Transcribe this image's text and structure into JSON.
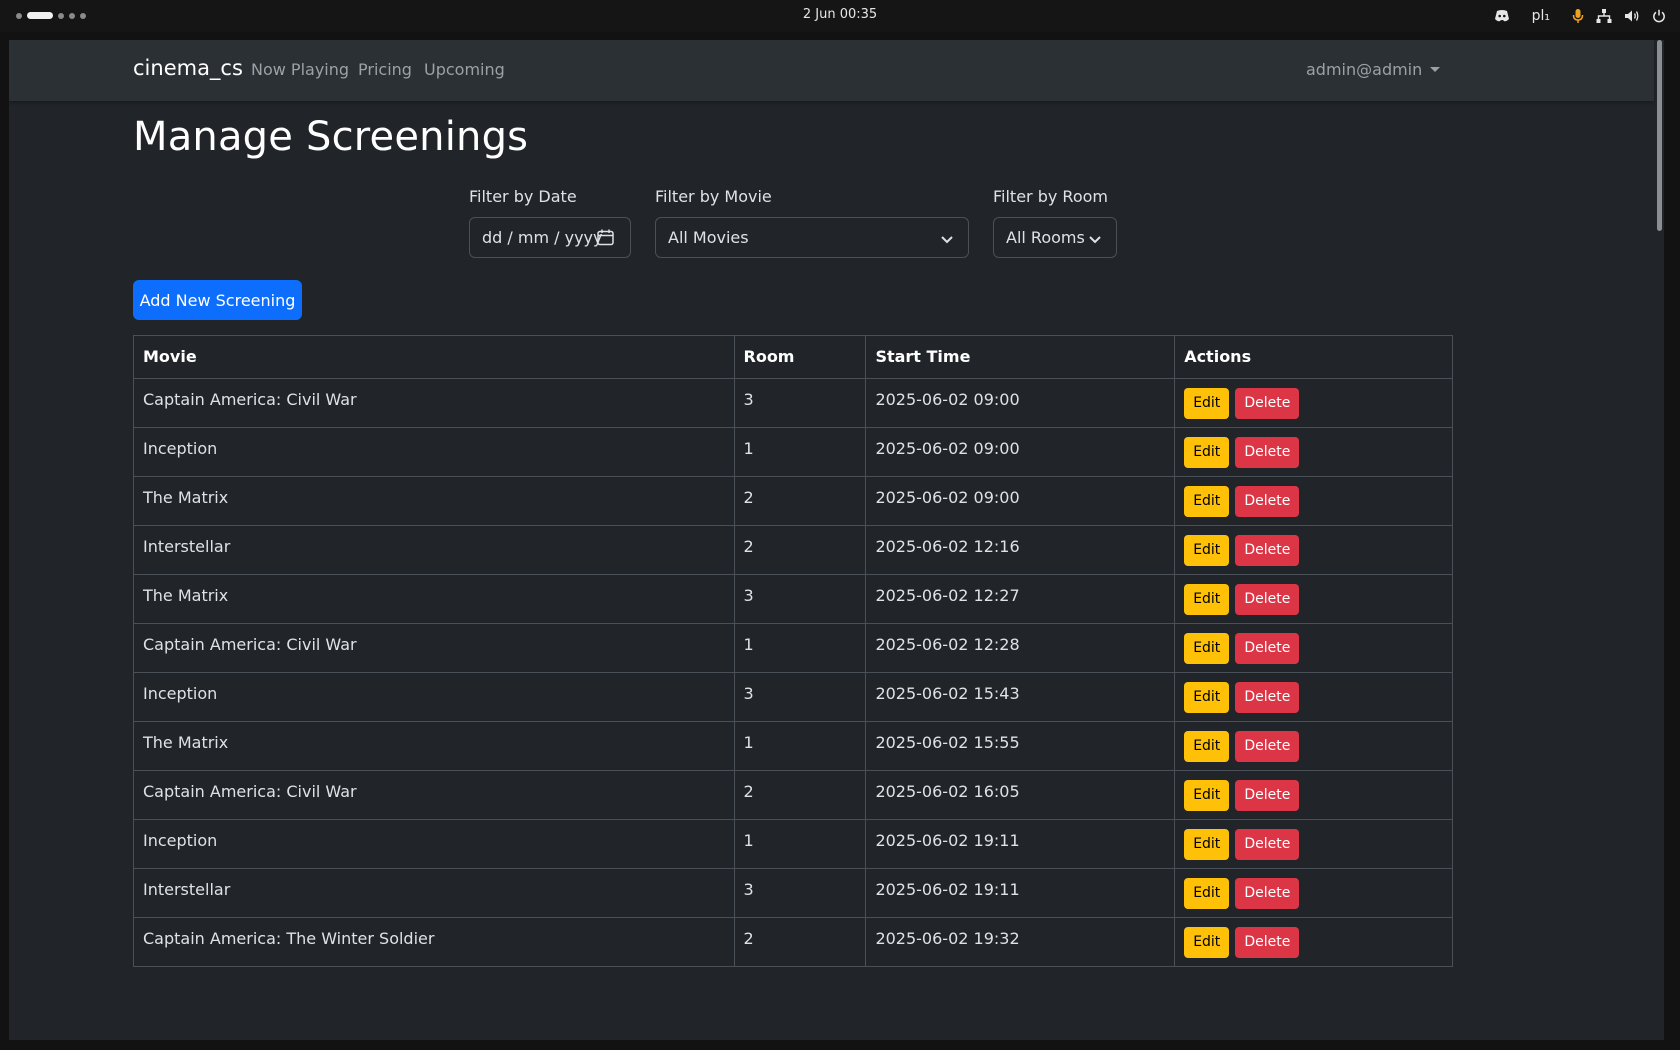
{
  "os": {
    "clock": "2 Jun  00:35",
    "keyboard_layout": "pl₁",
    "tray_icons": [
      "discord-icon",
      "microphone-icon",
      "network-icon",
      "volume-icon",
      "power-icon"
    ]
  },
  "navbar": {
    "brand": "cinema_cs",
    "links": [
      "Now Playing",
      "Pricing",
      "Upcoming"
    ],
    "user": "admin@admin"
  },
  "page": {
    "title": "Manage Screenings"
  },
  "filters": {
    "date_label": "Filter by Date",
    "date_placeholder": "dd / mm / yyyy",
    "movie_label": "Filter by Movie",
    "movie_value": "All Movies",
    "room_label": "Filter by Room",
    "room_value": "All Rooms"
  },
  "add_button": "Add New Screening",
  "table": {
    "headers": [
      "Movie",
      "Room",
      "Start Time",
      "Actions"
    ],
    "edit_label": "Edit",
    "delete_label": "Delete",
    "rows": [
      {
        "movie": "Captain America: Civil War",
        "room": "3",
        "start": "2025-06-02 09:00"
      },
      {
        "movie": "Inception",
        "room": "1",
        "start": "2025-06-02 09:00"
      },
      {
        "movie": "The Matrix",
        "room": "2",
        "start": "2025-06-02 09:00"
      },
      {
        "movie": "Interstellar",
        "room": "2",
        "start": "2025-06-02 12:16"
      },
      {
        "movie": "The Matrix",
        "room": "3",
        "start": "2025-06-02 12:27"
      },
      {
        "movie": "Captain America: Civil War",
        "room": "1",
        "start": "2025-06-02 12:28"
      },
      {
        "movie": "Inception",
        "room": "3",
        "start": "2025-06-02 15:43"
      },
      {
        "movie": "The Matrix",
        "room": "1",
        "start": "2025-06-02 15:55"
      },
      {
        "movie": "Captain America: Civil War",
        "room": "2",
        "start": "2025-06-02 16:05"
      },
      {
        "movie": "Inception",
        "room": "1",
        "start": "2025-06-02 19:11"
      },
      {
        "movie": "Interstellar",
        "room": "3",
        "start": "2025-06-02 19:11"
      },
      {
        "movie": "Captain America: The Winter Soldier",
        "room": "2",
        "start": "2025-06-02 19:32"
      }
    ]
  }
}
